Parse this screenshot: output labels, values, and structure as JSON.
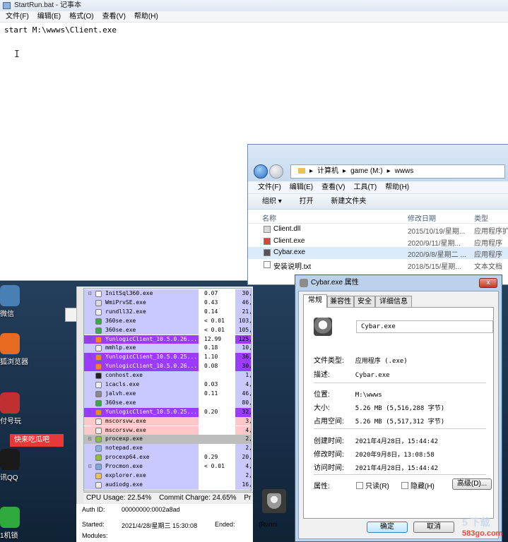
{
  "notepad": {
    "title": "StartRun.bat - 记事本",
    "menu": [
      "文件(F)",
      "编辑(E)",
      "格式(O)",
      "查看(V)",
      "帮助(H)"
    ],
    "content": "start M:\\wwws\\Client.exe"
  },
  "desktop": {
    "icons": [
      {
        "label": "微信",
        "icon": "wechat-icon",
        "color": "#4a7fb5"
      },
      {
        "label": "狐浏览器",
        "icon": "firefox-icon",
        "color": "#e66a1f"
      },
      {
        "label": "付号玩",
        "icon": "game-icon",
        "color": "#c03030"
      },
      {
        "label": "讯QQ",
        "icon": "qq-icon",
        "color": "#1a1a1a"
      },
      {
        "label": "1机锁",
        "icon": "lock-icon",
        "color": "#2eaa3c"
      }
    ],
    "tooltip": "快来吃瓜吧"
  },
  "process_explorer": {
    "rows": [
      {
        "tree": "⊟",
        "name": "InitSql360.exe",
        "cpu": "0.07",
        "mem": "30,",
        "bg": "#c9c9ff",
        "icon": "#ffffff"
      },
      {
        "tree": "",
        "name": "WmiPrvSE.exe",
        "cpu": "0.43",
        "mem": "46,",
        "bg": "#c9c9ff",
        "icon": "#dddddd"
      },
      {
        "tree": "",
        "name": "rundll32.exe",
        "cpu": "0.14",
        "mem": "21,",
        "bg": "#c9c9ff",
        "icon": "#eeeeee"
      },
      {
        "tree": "",
        "name": "360se.exe",
        "cpu": "< 0.01",
        "mem": "103,",
        "bg": "#c9c9ff",
        "icon": "#3da845"
      },
      {
        "tree": "",
        "name": "360se.exe",
        "cpu": "< 0.01",
        "mem": "105,",
        "bg": "#c9c9ff",
        "icon": "#3da845"
      },
      {
        "tree": "⊟",
        "name": "YunlogicClient_10.5.0.26...",
        "cpu": "12.99",
        "mem": "125,",
        "bg": "#9b3bff",
        "icon": "#f08a1d"
      },
      {
        "tree": "",
        "name": "mmhlp.exe",
        "cpu": "0.18",
        "mem": "10,",
        "bg": "#c9c9ff",
        "icon": "#eeeeee"
      },
      {
        "tree": "⊟",
        "name": "YunlogicClient_10.5.0.25...",
        "cpu": "1.10",
        "mem": "36,",
        "bg": "#9b3bff",
        "icon": "#f08a1d"
      },
      {
        "tree": "",
        "name": "YunlogicClient_10.5.0.26...",
        "cpu": "0.08",
        "mem": "30,",
        "bg": "#9b3bff",
        "icon": "#f08a1d"
      },
      {
        "tree": "",
        "name": "conhost.exe",
        "cpu": "",
        "mem": "1,",
        "bg": "#c9c9ff",
        "icon": "#222222"
      },
      {
        "tree": "",
        "name": "icacls.exe",
        "cpu": "0.03",
        "mem": "4,",
        "bg": "#c9c9ff",
        "icon": "#eeeeee"
      },
      {
        "tree": "",
        "name": "jalvh.exe",
        "cpu": "0.11",
        "mem": "46,",
        "bg": "#c9c9ff",
        "icon": "#888888"
      },
      {
        "tree": "",
        "name": "360se.exe",
        "cpu": "",
        "mem": "80,",
        "bg": "#c9c9ff",
        "icon": "#3da845"
      },
      {
        "tree": "⊟",
        "name": "YunlogicClient_10.5.0.25...",
        "cpu": "0.20",
        "mem": "32,",
        "bg": "#9b3bff",
        "icon": "#f08a1d"
      },
      {
        "tree": "",
        "name": "mscorsvw.exe",
        "cpu": "",
        "mem": "3,",
        "bg": "#ffc8c8",
        "icon": "#eeeeee"
      },
      {
        "tree": "",
        "name": "mscorsvw.exe",
        "cpu": "",
        "mem": "4,",
        "bg": "#ffc8c8",
        "icon": "#eeeeee"
      },
      {
        "tree": "⊟",
        "name": "procexp.exe",
        "cpu": "",
        "mem": "2,",
        "bg": "#bdbdbd",
        "icon": "#8fbf3a"
      },
      {
        "tree": "",
        "name": "notepad.exe",
        "cpu": "",
        "mem": "2,",
        "bg": "#c9c9ff",
        "icon": "#8fb3dc"
      },
      {
        "tree": "",
        "name": "procexp64.exe",
        "cpu": "0.29",
        "mem": "20,",
        "bg": "#c9c9ff",
        "icon": "#8fbf3a"
      },
      {
        "tree": "⊟",
        "name": "Procmon.exe",
        "cpu": "< 0.01",
        "mem": "4,",
        "bg": "#c9c9ff",
        "icon": "#7fa8d6"
      },
      {
        "tree": "",
        "name": "explorer.exe",
        "cpu": "",
        "mem": "2,",
        "bg": "#c9c9ff",
        "icon": "#e8c25a"
      },
      {
        "tree": "",
        "name": "audiodg.exe",
        "cpu": "",
        "mem": "16,",
        "bg": "#c9c9ff",
        "icon": "#eeeeee"
      }
    ],
    "status": {
      "cpu": "CPU Usage: 22.54%",
      "commit": "Commit Charge: 24.65%",
      "more": "Pr"
    },
    "detail": {
      "auth_label": "Auth ID:",
      "auth_value": "00000000:0002a8ad",
      "started_label": "Started:",
      "started_value": "2021/4/28/星期三 15:30:08",
      "ended_label": "Ended:",
      "ended_value": "(Runni",
      "modules_label": "Modules:"
    }
  },
  "explorer": {
    "address": [
      "计算机",
      "game (M:)",
      "wwws"
    ],
    "address_arrow": "▸",
    "menu": [
      "文件(F)",
      "编辑(E)",
      "查看(V)",
      "工具(T)",
      "帮助(H)"
    ],
    "toolbar": {
      "organize": "组织 ▾",
      "open": "打开",
      "new_folder": "新建文件夹"
    },
    "columns": {
      "name": "名称",
      "date": "修改日期",
      "type": "类型"
    },
    "files": [
      {
        "name": "Client.dll",
        "date": "2015/10/19/星期...",
        "type": "应用程序扩",
        "icon": "#d9d9d9",
        "selected": false
      },
      {
        "name": "Client.exe",
        "date": "2020/9/11/星期...",
        "type": "应用程序",
        "icon": "#d9453a",
        "selected": false
      },
      {
        "name": "Cybar.exe",
        "date": "2020/9/8/星期二 ...",
        "type": "应用程序",
        "icon": "#555555",
        "selected": true
      },
      {
        "name": "安装说明.txt",
        "date": "2018/5/15/星期...",
        "type": "文本文档",
        "icon": "#ffffff",
        "selected": false
      }
    ]
  },
  "properties": {
    "title": "Cybar.exe 属性",
    "close": "x",
    "tabs": [
      "常规",
      "兼容性",
      "安全",
      "详细信息"
    ],
    "file_name": "Cybar.exe",
    "fields": {
      "type_label": "文件类型:",
      "type_value": "应用程序 (.exe)",
      "desc_label": "描述:",
      "desc_value": "Cybar.exe",
      "location_label": "位置:",
      "location_value": "M:\\wwws",
      "size_label": "大小:",
      "size_value": "5.26 MB (5,516,288 字节)",
      "disk_label": "占用空间:",
      "disk_value": "5.26 MB (5,517,312 字节)",
      "created_label": "创建时间:",
      "created_value": "2021年4月28日，15:44:42",
      "modified_label": "修改时间:",
      "modified_value": "2020年9月8日，13:08:58",
      "accessed_label": "访问时间:",
      "accessed_value": "2021年4月28日，15:44:42",
      "attr_label": "属性:"
    },
    "attributes": {
      "readonly": "只读(R)",
      "hidden": "隐藏(H)",
      "advanced": "高级(D)..."
    },
    "buttons": {
      "ok": "确定",
      "cancel": "取消"
    }
  },
  "watermark": {
    "line1": "5 下载",
    "line2": "583go.com"
  }
}
